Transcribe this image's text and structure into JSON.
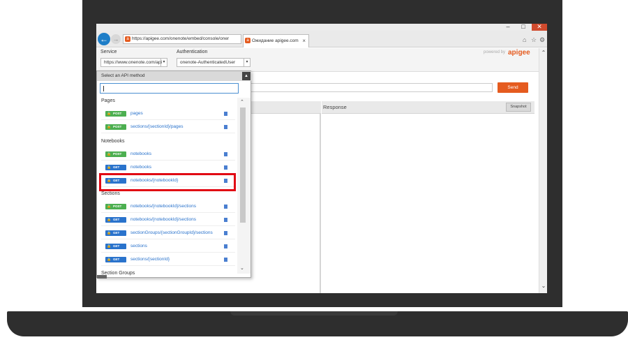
{
  "browser": {
    "address": "https://apigee.com/onenote/embed/console/oner",
    "tab_title": "Ожидание apigee.com",
    "tab_close": "×",
    "favicon": "a"
  },
  "header": {
    "service_label": "Service",
    "service_value": "https://www.onenote.com/api",
    "auth_label": "Authentication",
    "auth_value": "onenote-AuthenticatedUser",
    "powered_by": "powered by",
    "brand": "apigee"
  },
  "request": {
    "send_label": "Send"
  },
  "response": {
    "title": "Response",
    "snapshot_label": "Snapshot"
  },
  "api_menu": {
    "header": "Select an API method",
    "groups": [
      {
        "title": "Pages",
        "items": [
          {
            "method": "POST",
            "path": "pages"
          },
          {
            "method": "POST",
            "path": "sections/{sectionId}/pages"
          }
        ]
      },
      {
        "title": "Notebooks",
        "items": [
          {
            "method": "POST",
            "path": "notebooks"
          },
          {
            "method": "GET",
            "path": "notebooks"
          },
          {
            "method": "GET",
            "path": "notebooks/{notebookId}"
          }
        ]
      },
      {
        "title": "Sections",
        "items": [
          {
            "method": "POST",
            "path": "notebooks/{notebookId}/sections"
          },
          {
            "method": "GET",
            "path": "notebooks/{notebookId}/sections"
          },
          {
            "method": "GET",
            "path": "sectionGroups/{sectionGroupId}/sections"
          },
          {
            "method": "GET",
            "path": "sections"
          },
          {
            "method": "GET",
            "path": "sections/{sectionId}"
          }
        ]
      },
      {
        "title": "Section Groups",
        "items": []
      }
    ]
  },
  "colors": {
    "accent": "#e55b1f",
    "post_badge": "#4caf50",
    "get_badge": "#2a73cc",
    "highlight": "#e10613"
  }
}
